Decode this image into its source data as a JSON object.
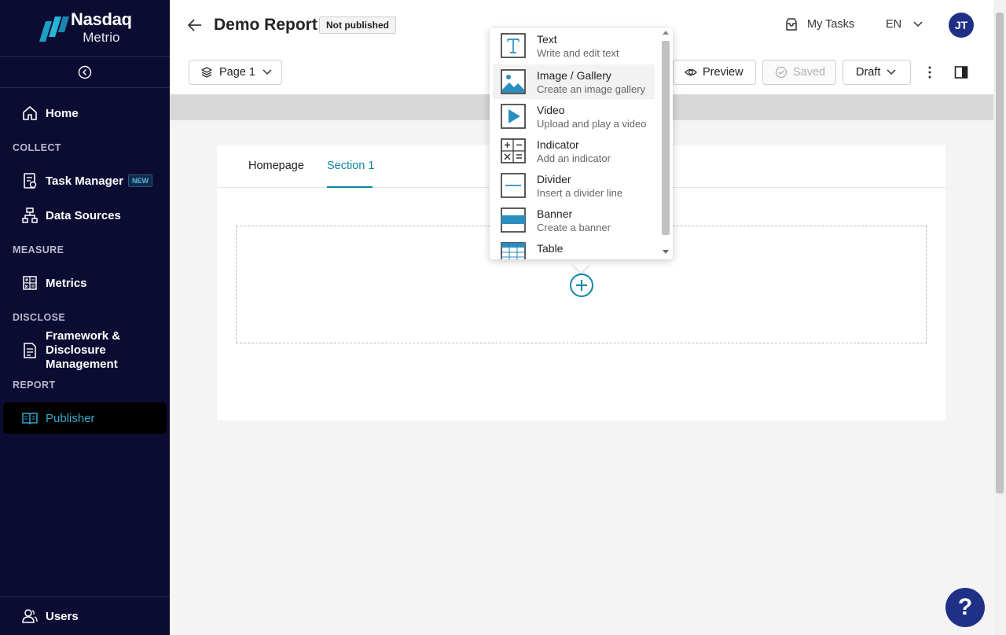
{
  "brand": {
    "name": "Nasdaq",
    "product": "Metrio"
  },
  "sidebar": {
    "home": "Home",
    "sections": {
      "collect": "COLLECT",
      "measure": "MEASURE",
      "disclose": "DISCLOSE",
      "report": "REPORT"
    },
    "task_manager": "Task Manager",
    "new_badge": "NEW",
    "data_sources": "Data Sources",
    "metrics": "Metrics",
    "framework": [
      "Framework &",
      "Disclosure",
      "Management"
    ],
    "publisher": "Publisher",
    "users": "Users"
  },
  "header": {
    "title": "Demo Report",
    "status": "Not published",
    "my_tasks": "My Tasks",
    "language": "EN",
    "avatar": "JT"
  },
  "toolbar": {
    "page": "Page 1",
    "preview": "Preview",
    "saved": "Saved",
    "draft": "Draft"
  },
  "tabs": [
    "Homepage",
    "Section 1"
  ],
  "menu": {
    "items": [
      {
        "title": "Text",
        "desc": "Write and edit text",
        "icon": "text-icon"
      },
      {
        "title": "Image / Gallery",
        "desc": "Create an image gallery",
        "icon": "image-icon"
      },
      {
        "title": "Video",
        "desc": "Upload and play a video",
        "icon": "video-icon"
      },
      {
        "title": "Indicator",
        "desc": "Add an indicator",
        "icon": "indicator-icon"
      },
      {
        "title": "Divider",
        "desc": "Insert a divider line",
        "icon": "divider-icon"
      },
      {
        "title": "Banner",
        "desc": "Create a banner",
        "icon": "banner-icon"
      },
      {
        "title": "Table",
        "desc": "",
        "icon": "table-icon"
      }
    ]
  },
  "help": "?",
  "colors": {
    "sidebar": "#0c0c33",
    "accent": "#0e86a6",
    "avatar": "#1f3187"
  }
}
